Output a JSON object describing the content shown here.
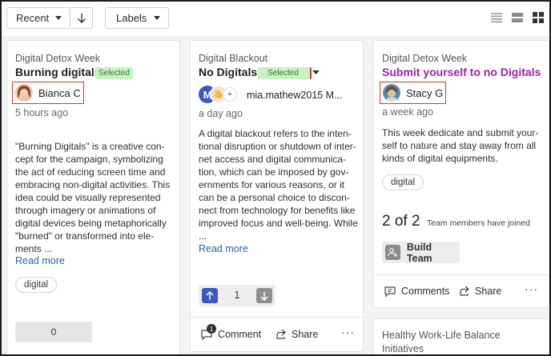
{
  "toolbar": {
    "sort_label": "Recent",
    "labels_label": "Labels"
  },
  "cards": [
    {
      "category": "Digital Detox Week",
      "title": "Burning digitals",
      "badge": "Selected",
      "author": "Bianca C",
      "time": "5 hours ago",
      "body": "\"Burning Digitals\" is a creative con-\ncept for the campaign, symbolizing\nthe act of reducing screen time and\nembracing non-digital activities. This\nidea could be visually represented\nthrough imagery or animations of\ndigital devices being metaphorically\n\"burned\" or transformed into ele-\nments ...",
      "read_more": "Read more",
      "tag": "digital",
      "count": "0"
    },
    {
      "category": "Digital Blackout",
      "title": "No Digitals",
      "badge": "Selected",
      "author": "mia.mathew2015 M...",
      "avatar_letter": "M",
      "avatar_extra": "+",
      "time": "a day ago",
      "body": "A digital blackout refers to the inten-\ntional disruption or shutdown of inter-\nnet access and digital communica-\ntion, which can be imposed by gov-\nernments for various reasons, or it\ncan be a personal choice to discon-\nnect from technology for benefits like\nimproved focus and well-being. While\n...",
      "read_more": "Read more",
      "vote_count": "1",
      "comment_label": "Comment",
      "comment_count": "1",
      "share_label": "Share"
    },
    {
      "category": "Digital Detox Week",
      "title": "Submit yourself to no Digitals",
      "author": "Stacy G",
      "time": "a week ago",
      "body": "This week dedicate and submit your-\nself to nature and stay away from all\nkinds of digital equipments.",
      "tag": "digital",
      "team_count": "2 of 2",
      "team_label": "Team members have joined",
      "build_team": "Build Team",
      "comments_label": "Comments",
      "share_label": "Share"
    },
    {
      "title": "Healthy Work-Life Balance\nInitiatives"
    }
  ],
  "colors": {
    "accent_blue": "#3a57c5",
    "title_purple": "#9b22a6",
    "highlight_red": "#d9352b",
    "selected_green": "#c9f1c3"
  }
}
